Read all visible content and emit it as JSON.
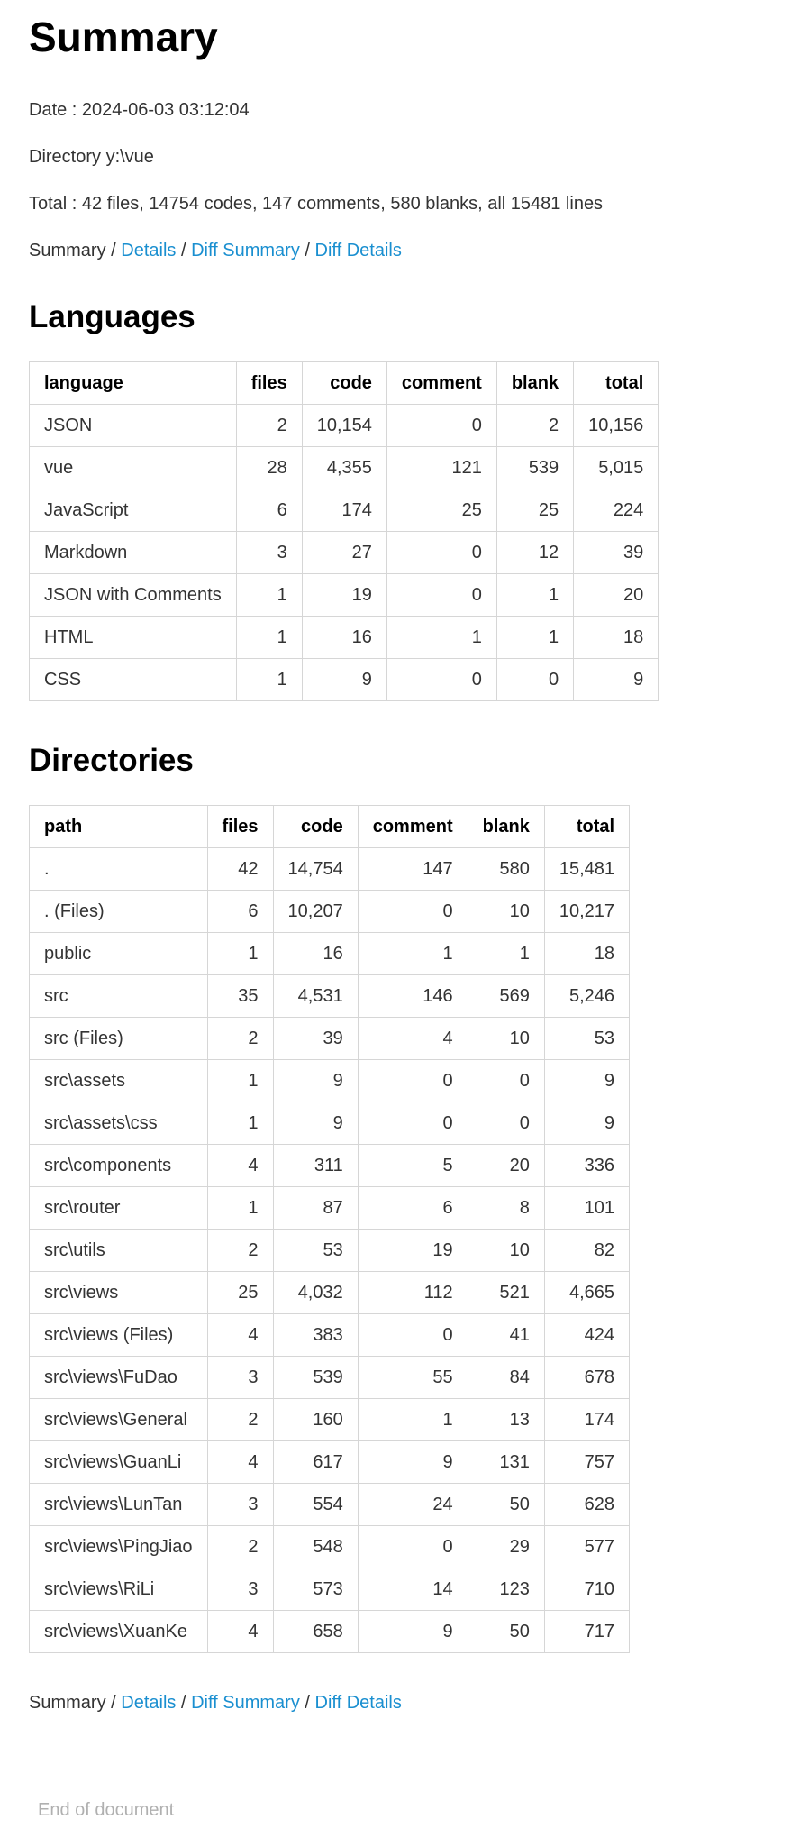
{
  "title": "Summary",
  "date_line": "Date : 2024-06-03 03:12:04",
  "directory_line": "Directory y:\\vue",
  "total_line": "Total : 42 files,  14754 codes, 147 comments, 580 blanks, all 15481 lines",
  "nav": {
    "summary": "Summary",
    "sep": " / ",
    "details": "Details",
    "diff_summary": "Diff Summary",
    "diff_details": "Diff Details"
  },
  "languages": {
    "heading": "Languages",
    "columns": [
      "language",
      "files",
      "code",
      "comment",
      "blank",
      "total"
    ],
    "rows": [
      [
        "JSON",
        "2",
        "10,154",
        "0",
        "2",
        "10,156"
      ],
      [
        "vue",
        "28",
        "4,355",
        "121",
        "539",
        "5,015"
      ],
      [
        "JavaScript",
        "6",
        "174",
        "25",
        "25",
        "224"
      ],
      [
        "Markdown",
        "3",
        "27",
        "0",
        "12",
        "39"
      ],
      [
        "JSON with Comments",
        "1",
        "19",
        "0",
        "1",
        "20"
      ],
      [
        "HTML",
        "1",
        "16",
        "1",
        "1",
        "18"
      ],
      [
        "CSS",
        "1",
        "9",
        "0",
        "0",
        "9"
      ]
    ]
  },
  "directories": {
    "heading": "Directories",
    "columns": [
      "path",
      "files",
      "code",
      "comment",
      "blank",
      "total"
    ],
    "rows": [
      [
        ".",
        "42",
        "14,754",
        "147",
        "580",
        "15,481"
      ],
      [
        ". (Files)",
        "6",
        "10,207",
        "0",
        "10",
        "10,217"
      ],
      [
        "public",
        "1",
        "16",
        "1",
        "1",
        "18"
      ],
      [
        "src",
        "35",
        "4,531",
        "146",
        "569",
        "5,246"
      ],
      [
        "src (Files)",
        "2",
        "39",
        "4",
        "10",
        "53"
      ],
      [
        "src\\assets",
        "1",
        "9",
        "0",
        "0",
        "9"
      ],
      [
        "src\\assets\\css",
        "1",
        "9",
        "0",
        "0",
        "9"
      ],
      [
        "src\\components",
        "4",
        "311",
        "5",
        "20",
        "336"
      ],
      [
        "src\\router",
        "1",
        "87",
        "6",
        "8",
        "101"
      ],
      [
        "src\\utils",
        "2",
        "53",
        "19",
        "10",
        "82"
      ],
      [
        "src\\views",
        "25",
        "4,032",
        "112",
        "521",
        "4,665"
      ],
      [
        "src\\views (Files)",
        "4",
        "383",
        "0",
        "41",
        "424"
      ],
      [
        "src\\views\\FuDao",
        "3",
        "539",
        "55",
        "84",
        "678"
      ],
      [
        "src\\views\\General",
        "2",
        "160",
        "1",
        "13",
        "174"
      ],
      [
        "src\\views\\GuanLi",
        "4",
        "617",
        "9",
        "131",
        "757"
      ],
      [
        "src\\views\\LunTan",
        "3",
        "554",
        "24",
        "50",
        "628"
      ],
      [
        "src\\views\\PingJiao",
        "2",
        "548",
        "0",
        "29",
        "577"
      ],
      [
        "src\\views\\RiLi",
        "3",
        "573",
        "14",
        "123",
        "710"
      ],
      [
        "src\\views\\XuanKe",
        "4",
        "658",
        "9",
        "50",
        "717"
      ]
    ]
  },
  "end_note": "End of document"
}
